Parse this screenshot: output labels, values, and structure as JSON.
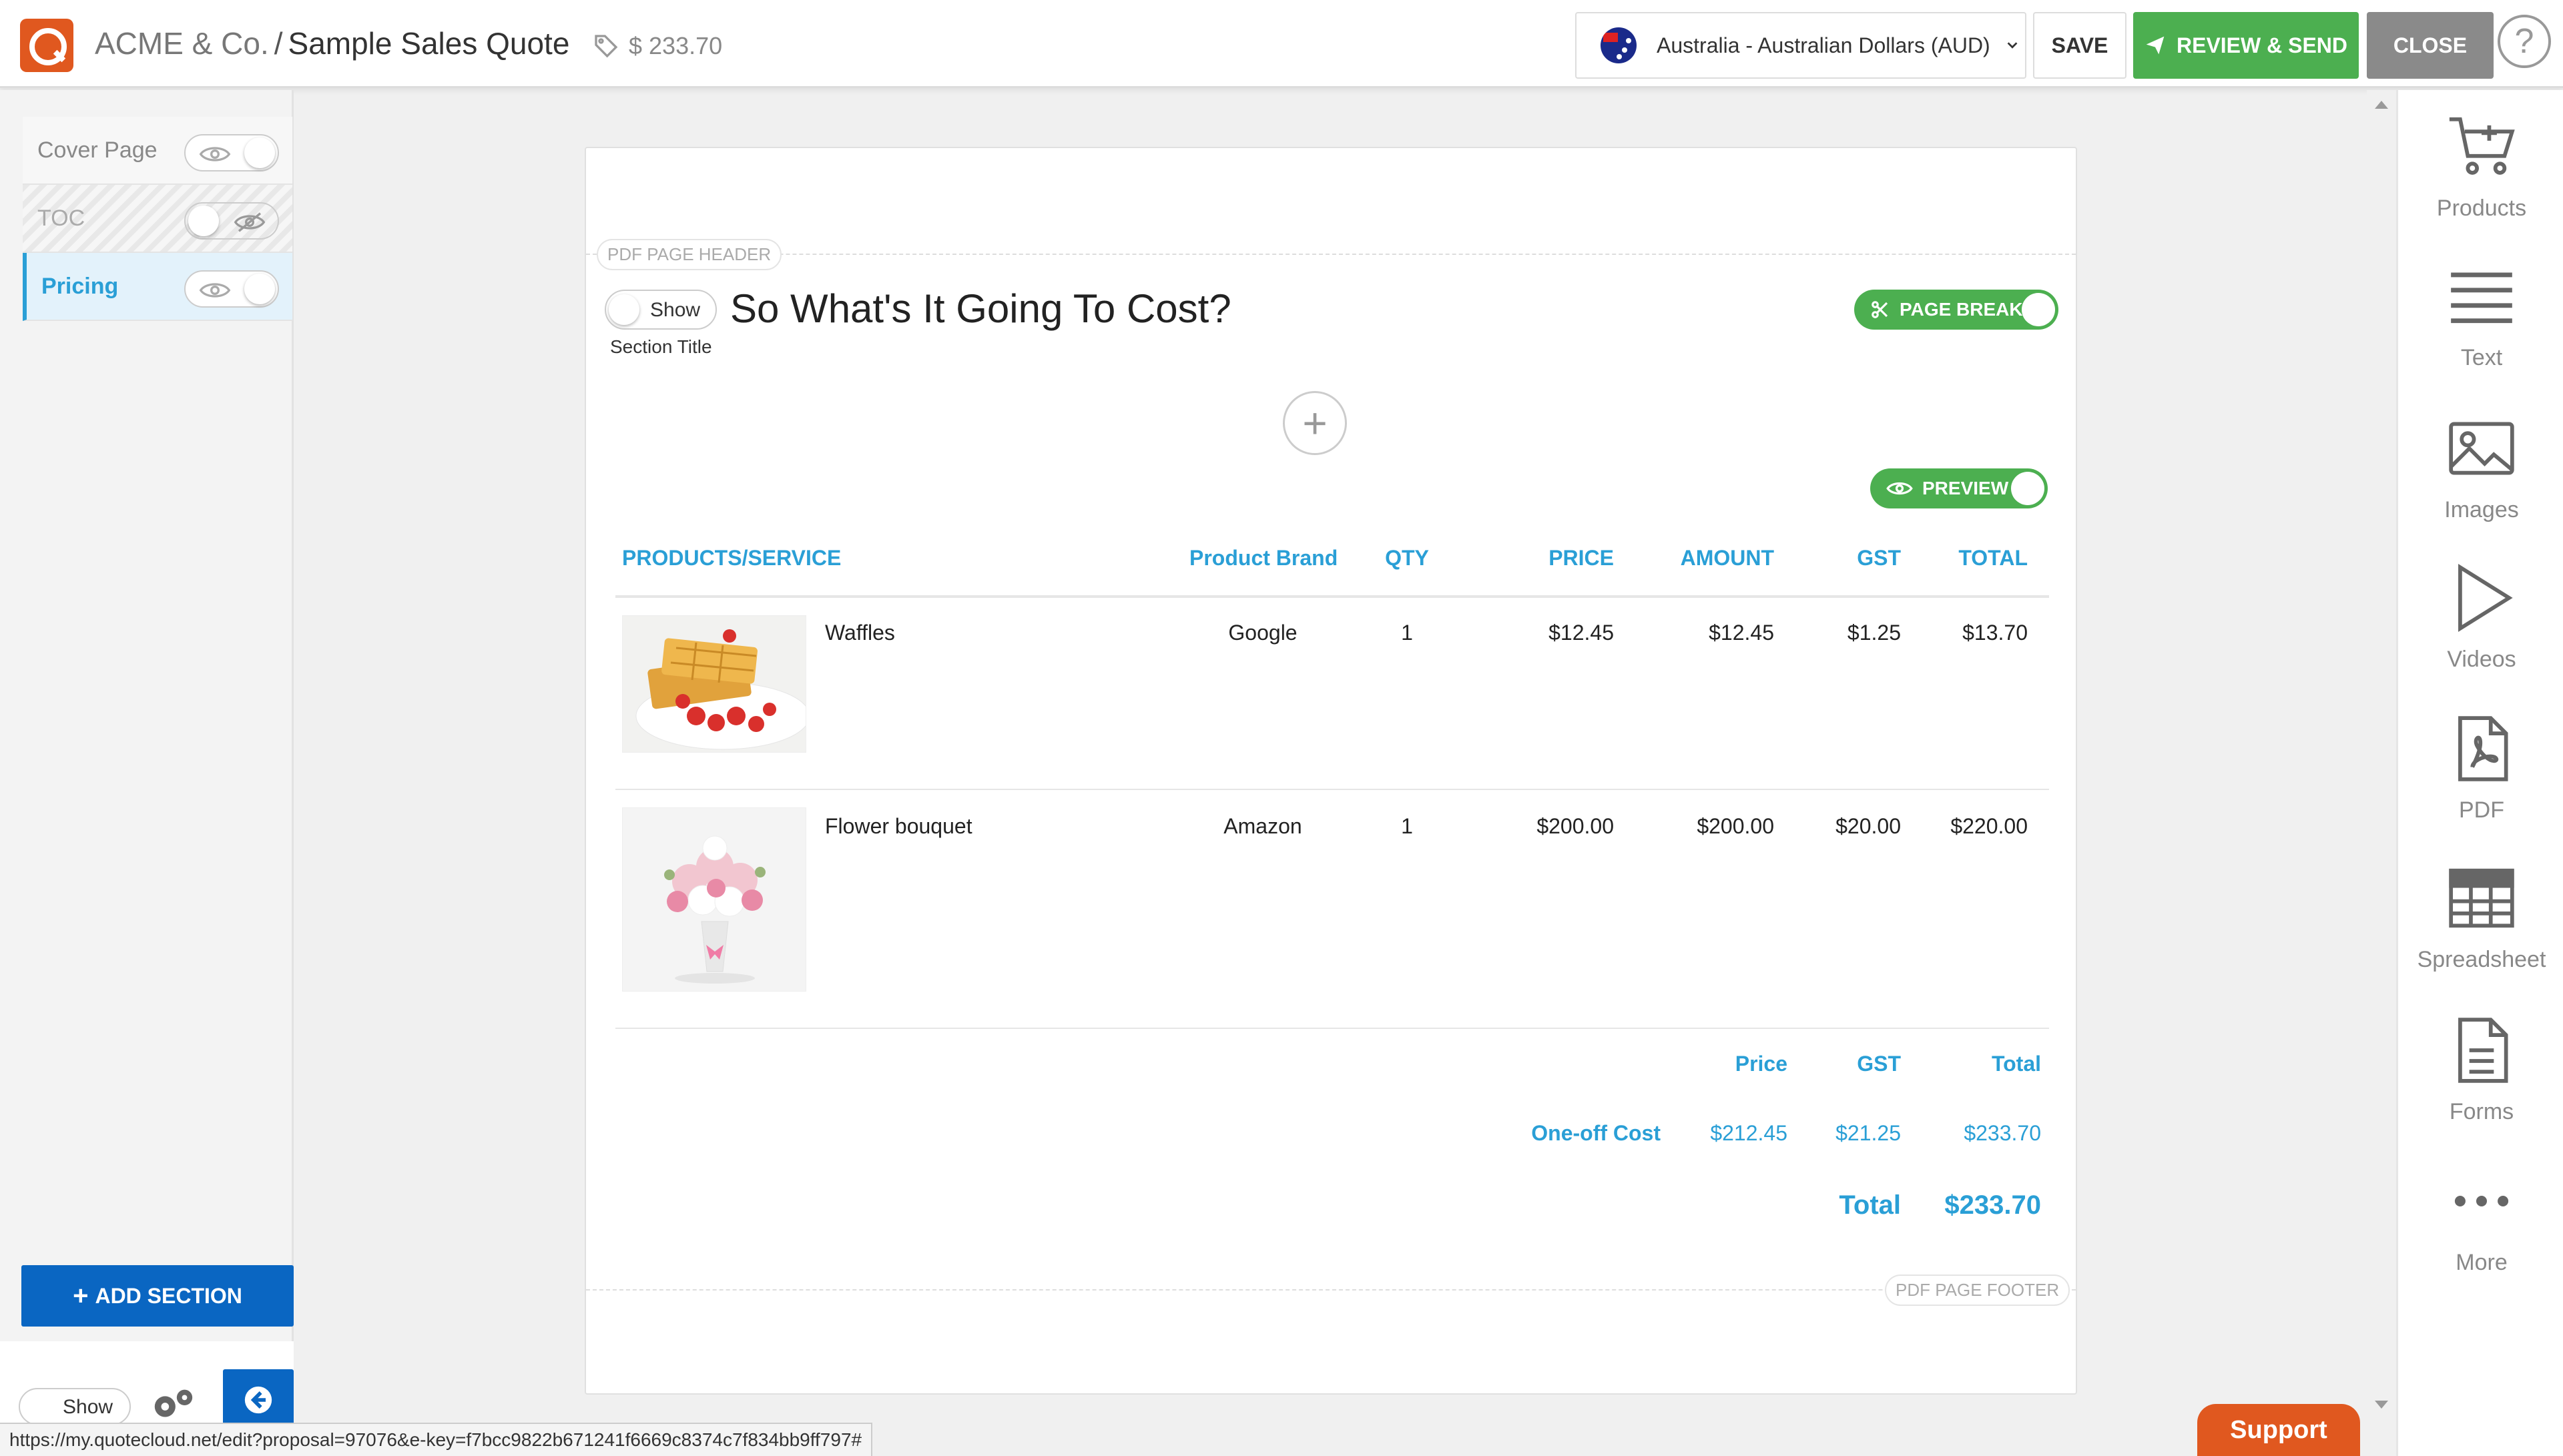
{
  "header": {
    "company": "ACME & Co.",
    "separator": "/",
    "document_title": "Sample Sales Quote",
    "price_tag": "$ 233.70",
    "currency_label": "Australia - Australian Dollars (AUD)",
    "save_label": "SAVE",
    "review_label": "REVIEW & SEND",
    "close_label": "CLOSE",
    "help_label": "?"
  },
  "sidebar": {
    "sections": [
      {
        "label": "Cover Page",
        "visible": true,
        "active": false
      },
      {
        "label": "TOC",
        "visible": false,
        "active": false
      },
      {
        "label": "Pricing",
        "visible": true,
        "active": true
      }
    ],
    "add_section_label": "ADD SECTION",
    "bottom_show_label": "Show"
  },
  "page": {
    "header_label": "PDF PAGE HEADER",
    "footer_label": "PDF PAGE FOOTER",
    "show_toggle_label": "Show",
    "section_title_caption": "Section Title",
    "section_heading": "So What's It Going To Cost?",
    "page_break_label": "PAGE BREAK",
    "preview_label": "PREVIEW",
    "add_block_label": "+"
  },
  "table": {
    "columns": [
      "PRODUCTS/SERVICE",
      "Product Brand",
      "QTY",
      "PRICE",
      "AMOUNT",
      "GST",
      "TOTAL"
    ],
    "rows": [
      {
        "name": "Waffles",
        "brand": "Google",
        "qty": "1",
        "price": "$12.45",
        "amount": "$12.45",
        "gst": "$1.25",
        "total": "$13.70",
        "image": "waffles-image"
      },
      {
        "name": "Flower bouquet",
        "brand": "Amazon",
        "qty": "1",
        "price": "$200.00",
        "amount": "$200.00",
        "gst": "$20.00",
        "total": "$220.00",
        "image": "bouquet-image"
      }
    ]
  },
  "summary": {
    "headers": [
      "Price",
      "GST",
      "Total"
    ],
    "one_off_label": "One-off Cost",
    "one_off_price": "$212.45",
    "one_off_gst": "$21.25",
    "one_off_total": "$233.70",
    "total_label": "Total",
    "total_value": "$233.70"
  },
  "tools": [
    {
      "label": "Products",
      "icon": "cart-plus-icon"
    },
    {
      "label": "Text",
      "icon": "text-lines-icon"
    },
    {
      "label": "Images",
      "icon": "image-icon"
    },
    {
      "label": "Videos",
      "icon": "play-icon"
    },
    {
      "label": "PDF",
      "icon": "pdf-icon"
    },
    {
      "label": "Spreadsheet",
      "icon": "spreadsheet-icon"
    },
    {
      "label": "Forms",
      "icon": "form-icon"
    },
    {
      "label": "More",
      "icon": "more-icon"
    }
  ],
  "support_label": "Support",
  "status_url": "https://my.quotecloud.net/edit?proposal=97076&e-key=f7bcc9822b671241f6669c8374c7f834bb9ff797#",
  "colors": {
    "accent_blue": "#2a9fd6",
    "green": "#4caf50",
    "brand_orange": "#e0581f",
    "add_section_blue": "#0a66c2",
    "close_gray": "#8a8a8a"
  }
}
